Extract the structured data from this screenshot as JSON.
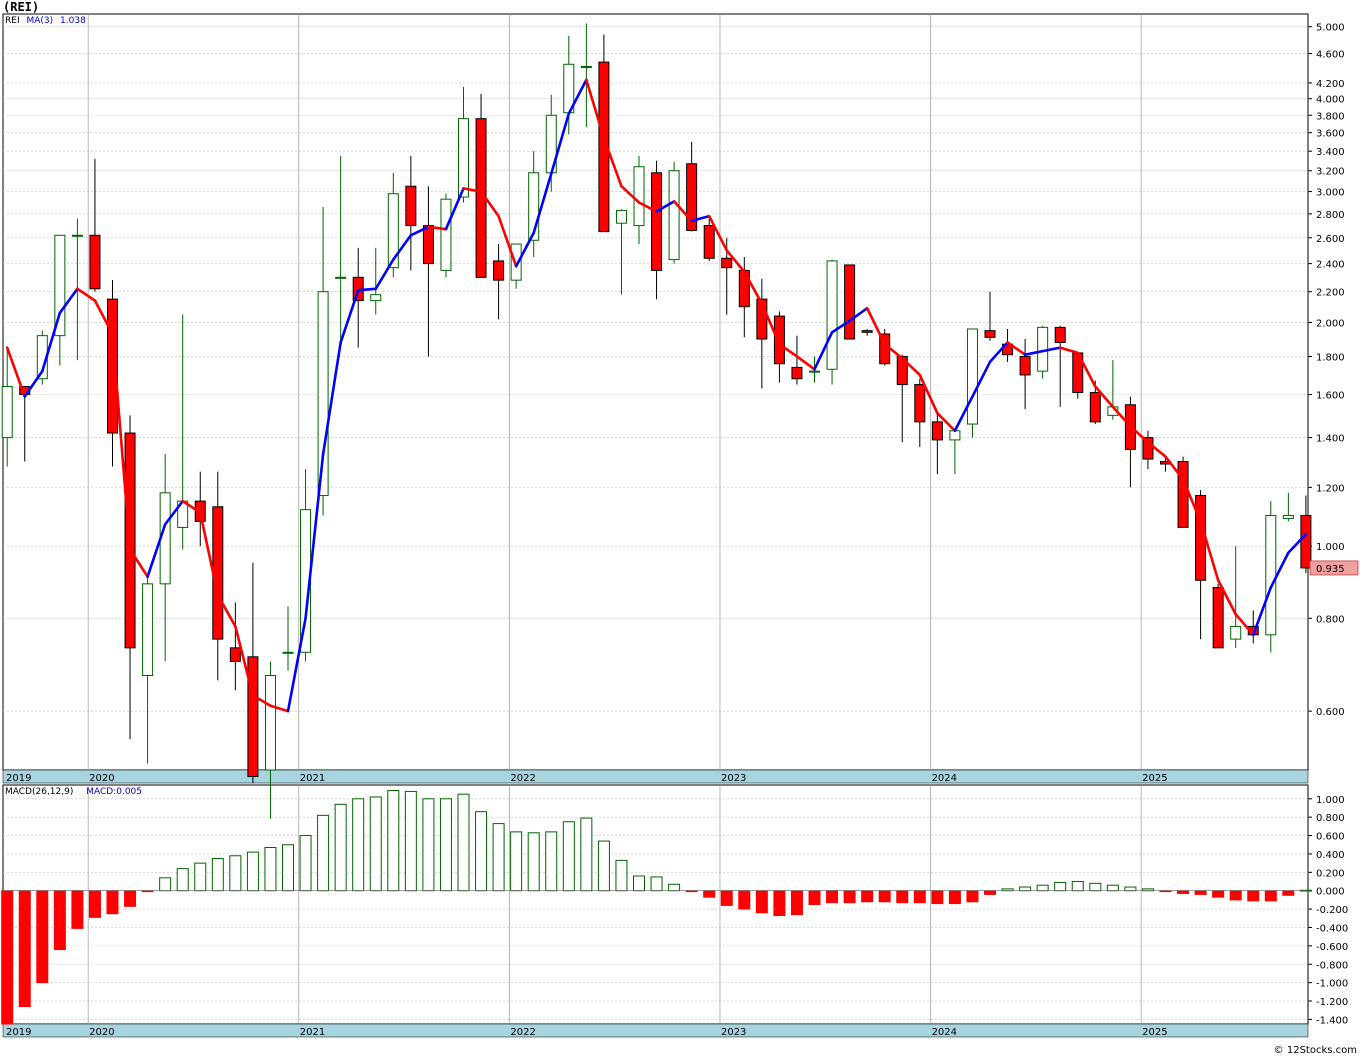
{
  "header": {
    "title": "(REI)",
    "ticker": "REI",
    "ma_label": "MA(3)",
    "ma_value": "1.038",
    "macd_label": "MACD(26,12,9)",
    "macd_value_label": "MACD:0.005",
    "last_price_label": "0.935",
    "credit": "© 12Stocks.com"
  },
  "colors": {
    "up_fill": "#ffffff",
    "up_stroke": "#006400",
    "down_fill": "#ff0000",
    "ma_up": "#0000ff",
    "ma_down": "#ff0000",
    "grid": "#c0c0c0",
    "axis_band": "#a8d4e0",
    "price_tag": "#f0a0a0"
  },
  "chart_data": [
    {
      "type": "candlestick",
      "title": "(REI)",
      "scale": "log",
      "ylim": [
        0.5,
        5.2
      ],
      "y_ticks": [
        "0.600",
        "0.800",
        "1.000",
        "1.200",
        "1.400",
        "1.600",
        "1.800",
        "2.000",
        "2.200",
        "2.400",
        "2.600",
        "2.800",
        "3.000",
        "3.200",
        "3.400",
        "3.600",
        "3.800",
        "4.000",
        "4.200",
        "4.600",
        "5.000"
      ],
      "x_labels": [
        "2019",
        "2020",
        "2021",
        "2022",
        "2023",
        "2024",
        "2025"
      ],
      "start": "2019-08",
      "interval": "month",
      "ohlc": [
        [
          1.4,
          1.85,
          1.28,
          1.64
        ],
        [
          1.64,
          1.64,
          1.3,
          1.6
        ],
        [
          1.68,
          1.95,
          1.65,
          1.92
        ],
        [
          1.92,
          2.62,
          1.75,
          2.62
        ],
        [
          2.62,
          2.76,
          1.78,
          2.62
        ],
        [
          2.62,
          3.32,
          2.2,
          2.22
        ],
        [
          2.15,
          2.28,
          1.28,
          1.42
        ],
        [
          1.42,
          1.5,
          0.55,
          0.73
        ],
        [
          0.67,
          0.91,
          0.51,
          0.89
        ],
        [
          0.89,
          1.33,
          0.7,
          1.18
        ],
        [
          1.06,
          2.05,
          0.99,
          1.15
        ],
        [
          1.15,
          1.26,
          1.0,
          1.08
        ],
        [
          1.13,
          1.26,
          0.66,
          0.75
        ],
        [
          0.73,
          0.84,
          0.64,
          0.7
        ],
        [
          0.71,
          0.95,
          0.48,
          0.49
        ],
        [
          0.5,
          0.7,
          0.43,
          0.67
        ],
        [
          0.72,
          0.83,
          0.68,
          0.72
        ],
        [
          0.72,
          1.27,
          0.7,
          1.12
        ],
        [
          1.17,
          2.86,
          1.1,
          2.2
        ],
        [
          2.3,
          3.35,
          1.86,
          2.3
        ],
        [
          2.3,
          2.52,
          1.85,
          2.14
        ],
        [
          2.14,
          2.52,
          2.05,
          2.18
        ],
        [
          2.37,
          3.18,
          2.3,
          2.98
        ],
        [
          3.05,
          3.35,
          2.35,
          2.7
        ],
        [
          2.7,
          3.05,
          1.8,
          2.4
        ],
        [
          2.35,
          2.98,
          2.3,
          2.93
        ],
        [
          2.95,
          4.15,
          2.9,
          3.76
        ],
        [
          3.76,
          4.06,
          2.3,
          2.3
        ],
        [
          2.42,
          2.55,
          2.02,
          2.28
        ],
        [
          2.28,
          2.55,
          2.22,
          2.55
        ],
        [
          2.58,
          3.4,
          2.45,
          3.18
        ],
        [
          3.18,
          4.05,
          3.0,
          3.8
        ],
        [
          3.83,
          4.86,
          3.58,
          4.45
        ],
        [
          4.42,
          5.05,
          3.66,
          4.42
        ],
        [
          4.48,
          4.88,
          2.72,
          2.65
        ],
        [
          2.72,
          2.84,
          2.18,
          2.83
        ],
        [
          2.7,
          3.35,
          2.55,
          3.24
        ],
        [
          3.18,
          3.3,
          2.15,
          2.35
        ],
        [
          2.43,
          3.29,
          2.4,
          3.2
        ],
        [
          3.27,
          3.5,
          2.65,
          2.66
        ],
        [
          2.7,
          2.79,
          2.42,
          2.44
        ],
        [
          2.44,
          2.6,
          2.05,
          2.37
        ],
        [
          2.35,
          2.45,
          1.91,
          2.1
        ],
        [
          2.15,
          2.29,
          1.63,
          1.9
        ],
        [
          2.04,
          2.07,
          1.66,
          1.76
        ],
        [
          1.74,
          1.92,
          1.65,
          1.68
        ],
        [
          1.72,
          1.8,
          1.66,
          1.72
        ],
        [
          1.73,
          2.43,
          1.65,
          2.42
        ],
        [
          2.39,
          2.39,
          1.9,
          1.9
        ],
        [
          1.95,
          1.96,
          1.92,
          1.94
        ],
        [
          1.93,
          1.96,
          1.75,
          1.76
        ],
        [
          1.8,
          1.81,
          1.38,
          1.65
        ],
        [
          1.65,
          1.68,
          1.36,
          1.47
        ],
        [
          1.47,
          1.51,
          1.25,
          1.39
        ],
        [
          1.39,
          1.42,
          1.25,
          1.43
        ],
        [
          1.46,
          1.96,
          1.4,
          1.96
        ],
        [
          1.95,
          2.2,
          1.89,
          1.91
        ],
        [
          1.87,
          1.96,
          1.77,
          1.81
        ],
        [
          1.8,
          1.9,
          1.53,
          1.7
        ],
        [
          1.72,
          1.98,
          1.68,
          1.97
        ],
        [
          1.97,
          1.98,
          1.54,
          1.88
        ],
        [
          1.82,
          1.82,
          1.58,
          1.61
        ],
        [
          1.61,
          1.67,
          1.46,
          1.47
        ],
        [
          1.5,
          1.78,
          1.48,
          1.54
        ],
        [
          1.55,
          1.59,
          1.2,
          1.35
        ],
        [
          1.4,
          1.43,
          1.27,
          1.31
        ],
        [
          1.3,
          1.32,
          1.26,
          1.29
        ],
        [
          1.3,
          1.32,
          1.15,
          1.06
        ],
        [
          1.17,
          1.19,
          0.75,
          0.9
        ],
        [
          0.88,
          0.89,
          0.73,
          0.73
        ],
        [
          0.75,
          1.0,
          0.73,
          0.78
        ],
        [
          0.78,
          0.82,
          0.74,
          0.76
        ],
        [
          0.76,
          1.15,
          0.72,
          1.1
        ],
        [
          1.09,
          1.18,
          1.08,
          1.1
        ],
        [
          1.1,
          1.17,
          0.92,
          0.935
        ]
      ],
      "ma": [
        1.85,
        1.59,
        1.72,
        2.06,
        2.22,
        2.14,
        1.93,
        0.99,
        0.91,
        1.07,
        1.15,
        1.11,
        0.86,
        0.78,
        0.63,
        0.61,
        0.6,
        0.8,
        1.33,
        1.88,
        2.21,
        2.22,
        2.43,
        2.62,
        2.69,
        2.67,
        3.03,
        3.0,
        2.78,
        2.38,
        2.64,
        3.17,
        3.82,
        4.24,
        3.54,
        3.05,
        2.9,
        2.82,
        2.91,
        2.74,
        2.78,
        2.5,
        2.34,
        2.12,
        1.87,
        1.8,
        1.73,
        1.94,
        2.01,
        2.09,
        1.87,
        1.79,
        1.7,
        1.51,
        1.43,
        1.59,
        1.77,
        1.88,
        1.81,
        1.83,
        1.85,
        1.82,
        1.64,
        1.54,
        1.45,
        1.38,
        1.32,
        1.23,
        1.08,
        0.9,
        0.81,
        0.76,
        0.88,
        0.98,
        1.038
      ],
      "ma_value": 1.038
    },
    {
      "type": "bar",
      "title": "MACD(26,12,9)",
      "ylim": [
        -1.45,
        1.15
      ],
      "y_ticks": [
        "1.000",
        "0.800",
        "0.600",
        "0.400",
        "0.200",
        "0.000",
        "-0.200",
        "-0.400",
        "-0.600",
        "-0.800",
        "-1.000",
        "-1.200",
        "-1.400"
      ],
      "x_labels": [
        "2019",
        "2020",
        "2021",
        "2022",
        "2023",
        "2024",
        "2025"
      ],
      "values": [
        -1.45,
        -1.26,
        -1.0,
        -0.64,
        -0.41,
        -0.29,
        -0.25,
        -0.17,
        -0.01,
        0.14,
        0.24,
        0.3,
        0.35,
        0.38,
        0.42,
        0.47,
        0.5,
        0.6,
        0.82,
        0.94,
        1.0,
        1.02,
        1.09,
        1.08,
        1.0,
        1.0,
        1.05,
        0.86,
        0.73,
        0.64,
        0.63,
        0.64,
        0.75,
        0.79,
        0.54,
        0.33,
        0.16,
        0.15,
        0.07,
        -0.01,
        -0.07,
        -0.16,
        -0.2,
        -0.24,
        -0.27,
        -0.26,
        -0.15,
        -0.13,
        -0.13,
        -0.12,
        -0.12,
        -0.13,
        -0.13,
        -0.14,
        -0.14,
        -0.12,
        -0.04,
        0.02,
        0.04,
        0.06,
        0.09,
        0.1,
        0.08,
        0.06,
        0.04,
        0.02,
        -0.01,
        -0.03,
        -0.04,
        -0.07,
        -0.1,
        -0.11,
        -0.11,
        -0.05,
        0.005
      ],
      "macd_value": 0.005
    }
  ]
}
